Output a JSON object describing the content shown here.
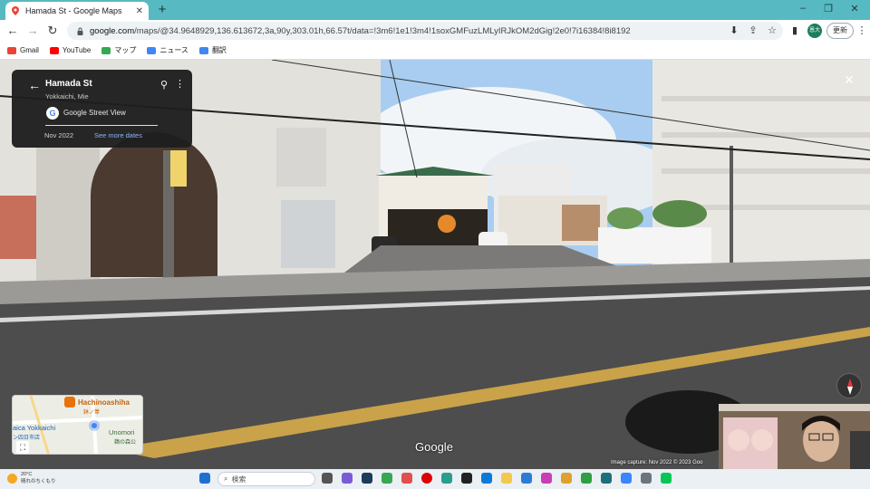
{
  "browser": {
    "tab_title": "Hamada St - Google Maps",
    "url_domain": "google.com",
    "url_path": "/maps/@34.9648929,136.613672,3a,90y,303.01h,66.57t/data=!3m6!1e1!3m4!1soxGMFuzLMLyIRJkOM2dGig!2e0!7i16384!8i8192",
    "profile_label": "恩大",
    "update_label": "更新",
    "bookmarks": [
      {
        "label": "Gmail",
        "color": "#ea4335"
      },
      {
        "label": "YouTube",
        "color": "#ff0000"
      },
      {
        "label": "マップ",
        "color": "#34a853"
      },
      {
        "label": "ニュース",
        "color": "#4285f4"
      },
      {
        "label": "翻訳",
        "color": "#4285f4"
      }
    ]
  },
  "streetview": {
    "place_name": "Hamada St",
    "place_sub": "Yokkaichi, Mie",
    "provider": "Google Street View",
    "date": "Nov 2022",
    "see_more": "See more dates",
    "google_logo": "Google",
    "capture_text": "Image capture: Nov 2022   © 2023 Goo",
    "minimap": {
      "label_top": "Hachinoashiha",
      "label_top_sub": "鉢ノ葦",
      "label_left": "aica Yokkaichi",
      "label_left_sub": "ン四日市店",
      "label_right": "Unomori",
      "label_right_sub": "鵜の森公"
    }
  },
  "taskbar": {
    "weather_temp": "20°C",
    "weather_text": "晴れのちくもり",
    "search_placeholder": "検索"
  },
  "colors": {
    "tabbar": "#57b9c1",
    "accent_link": "#8ab4f8"
  }
}
